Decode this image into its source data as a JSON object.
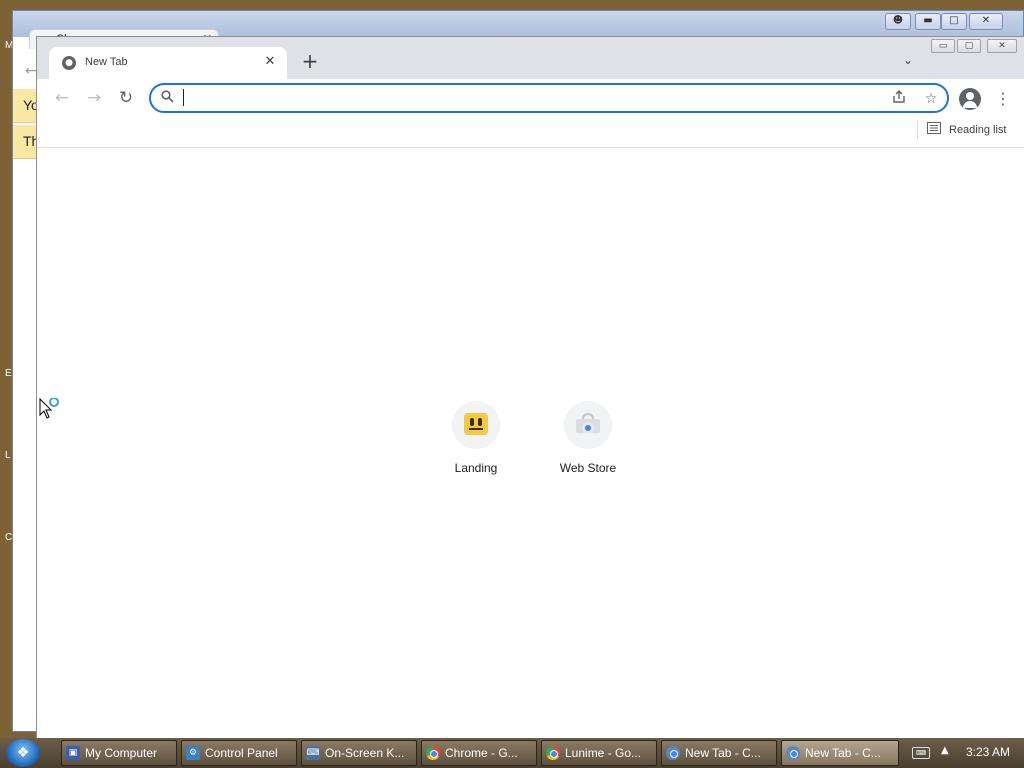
{
  "desktop": {
    "edge_letters": [
      "M",
      "E",
      "L",
      "C"
    ]
  },
  "background_window": {
    "tab_title": "Ch",
    "notices": [
      "Yo",
      "Th"
    ],
    "back_glyph": "←"
  },
  "browser": {
    "tab": {
      "title": "New Tab",
      "close_glyph": "✕"
    },
    "new_tab_glyph": "+",
    "tab_search_glyph": "⌄",
    "nav": {
      "back_glyph": "←",
      "forward_glyph": "→",
      "reload_glyph": "↻"
    },
    "omnibox": {
      "value": "",
      "placeholder": ""
    },
    "reading_list_label": "Reading list",
    "shortcuts": [
      {
        "label": "Landing",
        "icon": "landing-face-icon"
      },
      {
        "label": "Web Store",
        "icon": "web-store-icon"
      }
    ],
    "window_controls": {
      "minimize": "▭",
      "maximize": "▢",
      "close": "✕"
    }
  },
  "taskbar": {
    "items": [
      {
        "label": "My Computer",
        "icon": "computer-icon"
      },
      {
        "label": "Control Panel",
        "icon": "control-panel-icon"
      },
      {
        "label": "On-Screen K...",
        "icon": "keyboard-icon"
      },
      {
        "label": "Chrome - G...",
        "icon": "chrome-icon"
      },
      {
        "label": "Lunime - Go...",
        "icon": "chrome-icon"
      },
      {
        "label": "New Tab - C...",
        "icon": "chrome-icon"
      },
      {
        "label": "New Tab - C...",
        "icon": "chrome-icon",
        "active": true
      }
    ],
    "clock": "3:23 AM"
  },
  "colors": {
    "accent": "#1a73e8",
    "desktop": "#7d6236",
    "tabstrip": "#dee1e6"
  }
}
